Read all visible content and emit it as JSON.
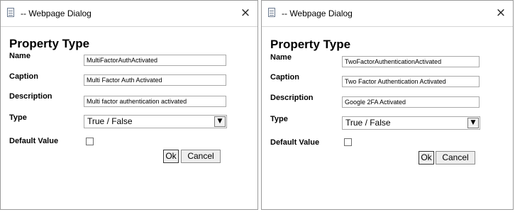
{
  "dialogs": [
    {
      "title": "-- Webpage Dialog",
      "close_glyph": "×",
      "title_icon": "page-icon",
      "heading": "Property Type",
      "labels": {
        "name": "Name",
        "caption": "Caption",
        "description": "Description",
        "type": "Type",
        "default_value": "Default Value"
      },
      "fields": {
        "name": "MultiFactorAuthActivated",
        "caption": "Multi Factor Auth Activated",
        "description": "Multi factor authentication activated",
        "type": "True / False",
        "type_arrow": "▼",
        "default_value_checked": false
      },
      "buttons": {
        "ok": "Ok",
        "cancel": "Cancel"
      }
    },
    {
      "title": "-- Webpage Dialog",
      "close_glyph": "×",
      "title_icon": "page-icon",
      "heading": "Property Type",
      "labels": {
        "name": "Name",
        "caption": "Caption",
        "description": "Description",
        "type": "Type",
        "default_value": "Default Value"
      },
      "fields": {
        "name": "TwoFactorAuthenticationActivated",
        "caption": "Two Factor Authentication Activated",
        "description": "Google 2FA Activated",
        "type": "True / False",
        "type_arrow": "▼",
        "default_value_checked": false
      },
      "buttons": {
        "ok": "Ok",
        "cancel": "Cancel"
      }
    }
  ]
}
